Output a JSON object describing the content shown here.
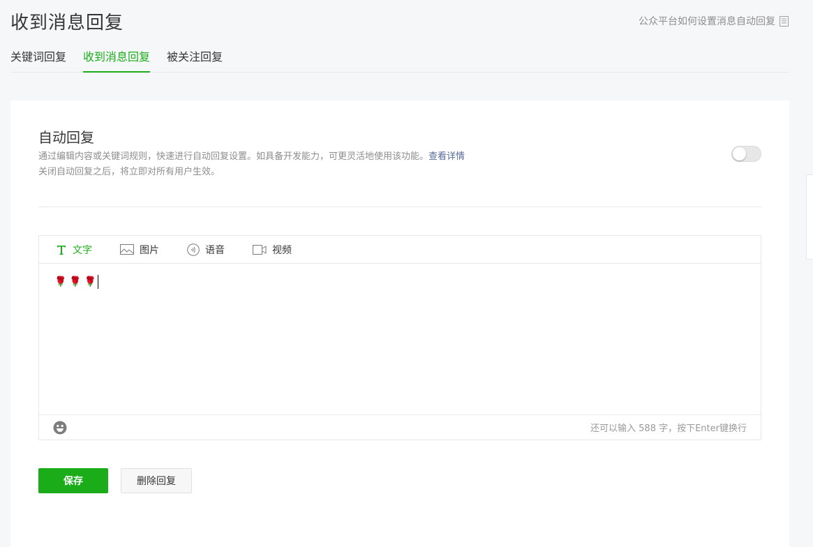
{
  "page": {
    "title": "收到消息回复",
    "help_link": "公众平台如何设置消息自动回复"
  },
  "tabs": [
    {
      "label": "关键词回复",
      "active": false
    },
    {
      "label": "收到消息回复",
      "active": true
    },
    {
      "label": "被关注回复",
      "active": false
    }
  ],
  "auto_reply": {
    "title": "自动回复",
    "desc_line1": "通过编辑内容或关键词规则，快速进行自动回复设置。如具备开发能力，可更灵活地使用该功能。",
    "desc_link": "查看详情",
    "desc_line2": "关闭自动回复之后，将立即对所有用户生效。",
    "toggle_on": false
  },
  "editor": {
    "tabs": [
      {
        "label": "文字",
        "icon": "text-icon",
        "active": true
      },
      {
        "label": "图片",
        "icon": "image-icon",
        "active": false
      },
      {
        "label": "语音",
        "icon": "voice-icon",
        "active": false
      },
      {
        "label": "视频",
        "icon": "video-icon",
        "active": false
      }
    ],
    "content": "🌹🌹🌹",
    "char_tip": "还可以输入 588 字，按下Enter键换行"
  },
  "buttons": {
    "save": "保存",
    "delete": "删除回复"
  },
  "colors": {
    "accent": "#1aad19",
    "link": "#576b95",
    "background": "#f6f7f9"
  }
}
